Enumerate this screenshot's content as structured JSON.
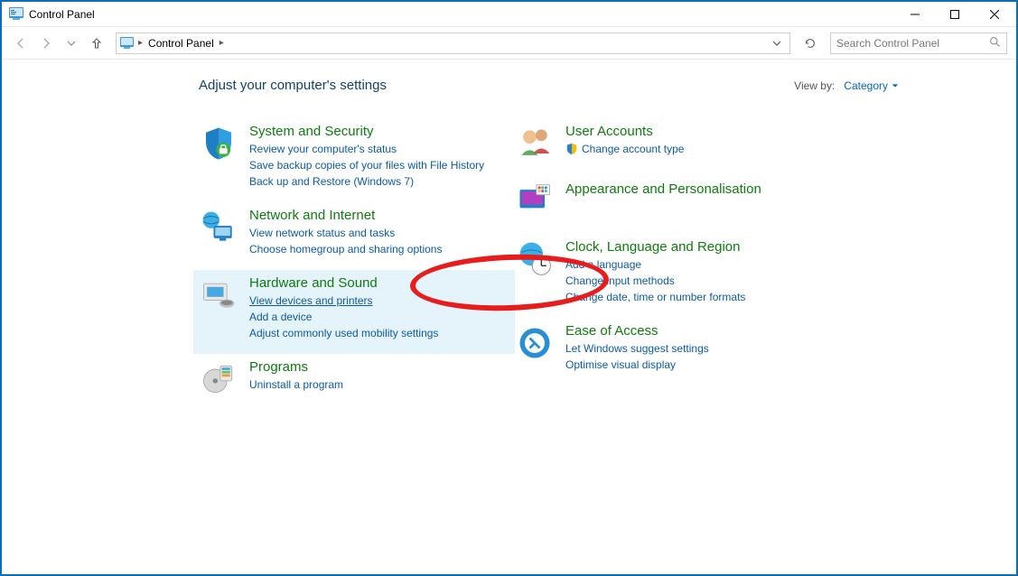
{
  "titlebar": {
    "title": "Control Panel"
  },
  "toolbar": {
    "breadcrumb": "Control Panel",
    "search_placeholder": "Search Control Panel"
  },
  "header": {
    "heading": "Adjust your computer's settings",
    "viewby_label": "View by:",
    "viewby_value": "Category"
  },
  "left_categories": [
    {
      "title": "System and Security",
      "links": [
        "Review your computer's status",
        "Save backup copies of your files with File History",
        "Back up and Restore (Windows 7)"
      ]
    },
    {
      "title": "Network and Internet",
      "links": [
        "View network status and tasks",
        "Choose homegroup and sharing options"
      ]
    },
    {
      "title": "Hardware and Sound",
      "links": [
        "View devices and printers",
        "Add a device",
        "Adjust commonly used mobility settings"
      ]
    },
    {
      "title": "Programs",
      "links": [
        "Uninstall a program"
      ]
    }
  ],
  "right_categories": [
    {
      "title": "User Accounts",
      "links": [
        "Change account type"
      ],
      "shield_links": [
        0
      ]
    },
    {
      "title": "Appearance and Personalisation",
      "links": []
    },
    {
      "title": "Clock, Language and Region",
      "links": [
        "Add a language",
        "Change input methods",
        "Change date, time or number formats"
      ]
    },
    {
      "title": "Ease of Access",
      "links": [
        "Let Windows suggest settings",
        "Optimise visual display"
      ]
    }
  ]
}
